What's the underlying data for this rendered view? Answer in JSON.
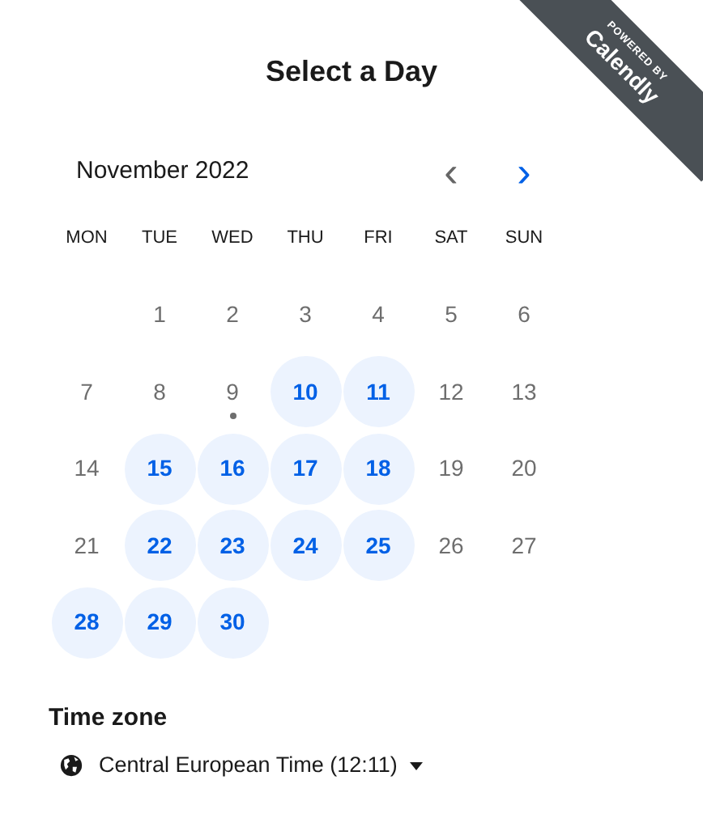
{
  "ribbon": {
    "caption": "POWERED BY",
    "brand": "Calendly"
  },
  "title": "Select a Day",
  "calendar": {
    "month": "November 2022",
    "prev": {
      "symbol": "‹",
      "disabled": true
    },
    "next": {
      "symbol": "›",
      "disabled": false
    },
    "weekdays": [
      "MON",
      "TUE",
      "WED",
      "THU",
      "FRI",
      "SAT",
      "SUN"
    ],
    "weeks": [
      [
        {
          "kind": "empty"
        },
        {
          "kind": "day",
          "label": "1",
          "available": false,
          "today": false
        },
        {
          "kind": "day",
          "label": "2",
          "available": false,
          "today": false
        },
        {
          "kind": "day",
          "label": "3",
          "available": false,
          "today": false
        },
        {
          "kind": "day",
          "label": "4",
          "available": false,
          "today": false
        },
        {
          "kind": "day",
          "label": "5",
          "available": false,
          "today": false
        },
        {
          "kind": "day",
          "label": "6",
          "available": false,
          "today": false
        }
      ],
      [
        {
          "kind": "day",
          "label": "7",
          "available": false,
          "today": false
        },
        {
          "kind": "day",
          "label": "8",
          "available": false,
          "today": false
        },
        {
          "kind": "day",
          "label": "9",
          "available": false,
          "today": true
        },
        {
          "kind": "day",
          "label": "10",
          "available": true,
          "today": false
        },
        {
          "kind": "day",
          "label": "11",
          "available": true,
          "today": false
        },
        {
          "kind": "day",
          "label": "12",
          "available": false,
          "today": false
        },
        {
          "kind": "day",
          "label": "13",
          "available": false,
          "today": false
        }
      ],
      [
        {
          "kind": "day",
          "label": "14",
          "available": false,
          "today": false
        },
        {
          "kind": "day",
          "label": "15",
          "available": true,
          "today": false
        },
        {
          "kind": "day",
          "label": "16",
          "available": true,
          "today": false
        },
        {
          "kind": "day",
          "label": "17",
          "available": true,
          "today": false
        },
        {
          "kind": "day",
          "label": "18",
          "available": true,
          "today": false
        },
        {
          "kind": "day",
          "label": "19",
          "available": false,
          "today": false
        },
        {
          "kind": "day",
          "label": "20",
          "available": false,
          "today": false
        }
      ],
      [
        {
          "kind": "day",
          "label": "21",
          "available": false,
          "today": false
        },
        {
          "kind": "day",
          "label": "22",
          "available": true,
          "today": false
        },
        {
          "kind": "day",
          "label": "23",
          "available": true,
          "today": false
        },
        {
          "kind": "day",
          "label": "24",
          "available": true,
          "today": false
        },
        {
          "kind": "day",
          "label": "25",
          "available": true,
          "today": false
        },
        {
          "kind": "day",
          "label": "26",
          "available": false,
          "today": false
        },
        {
          "kind": "day",
          "label": "27",
          "available": false,
          "today": false
        }
      ],
      [
        {
          "kind": "day",
          "label": "28",
          "available": true,
          "today": false
        },
        {
          "kind": "day",
          "label": "29",
          "available": true,
          "today": false
        },
        {
          "kind": "day",
          "label": "30",
          "available": true,
          "today": false
        }
      ]
    ]
  },
  "time_zone": {
    "heading": "Time zone",
    "value": "Central European Time (12:11)"
  }
}
